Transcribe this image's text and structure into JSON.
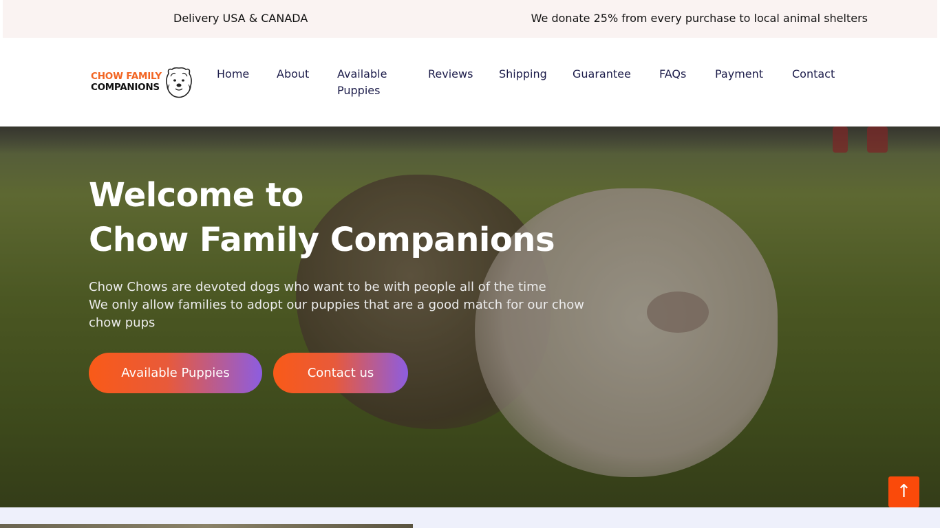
{
  "topbar": {
    "left_text": "Delivery USA & CANADA",
    "right_text": "We donate 25% from every purchase to local animal shelters"
  },
  "logo": {
    "line1": "CHOW FAMILY",
    "line2": "COMPANIONS",
    "icon": "chow-dog-face-icon"
  },
  "nav": {
    "items": [
      {
        "label": "Home"
      },
      {
        "label": "About"
      },
      {
        "label": "Available Puppies"
      },
      {
        "label": "Reviews"
      },
      {
        "label": "Shipping"
      },
      {
        "label": "Guarantee"
      },
      {
        "label": "FAQs"
      },
      {
        "label": "Payment"
      },
      {
        "label": "Contact"
      }
    ]
  },
  "hero": {
    "title_line1": "Welcome to",
    "title_line2": "Chow Family Companions",
    "text_line1": "Chow Chows are devoted dogs who want to be with people all of the time",
    "text_line2": "We only allow families to adopt our puppies that are a good match for our chow chow pups",
    "primary_button": "Available Puppies",
    "secondary_button": "Contact us"
  },
  "scroll_top": {
    "icon": "arrow-up-icon",
    "glyph": "↑"
  },
  "colors": {
    "accent": "#fa4a0a",
    "gradient_start": "#f95a18",
    "gradient_end": "#8d5de0",
    "topbar_bg": "#faf3f2",
    "nav_text": "#1c1c4a",
    "logo_orange": "#f26522"
  }
}
